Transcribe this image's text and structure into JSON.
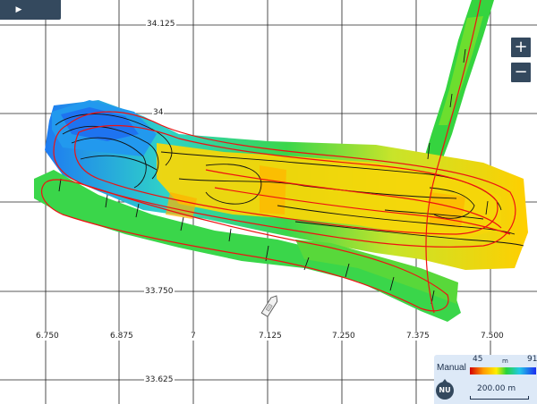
{
  "controls": {
    "play": "▶",
    "zoom_in": "+",
    "zoom_out": "−"
  },
  "grid": {
    "lat_labels": [
      "34.125",
      "34",
      "33.750",
      "33.625"
    ],
    "lon_labels": [
      "6.750",
      "6.875",
      "7",
      "7.125",
      "7.250",
      "7.375",
      "7.500"
    ]
  },
  "legend": {
    "mode": "Manual",
    "depth_min": "45",
    "depth_unit": "m",
    "depth_max": "91",
    "north_label": "NU",
    "scale": "200.00 m"
  },
  "colors": {
    "grid_line": "#222222",
    "track_line": "#ee1111",
    "contour_line": "#111111",
    "panel_bg": "#dde9f7",
    "control_bg": "#34495e",
    "depth_shallow": "#ffdd00",
    "depth_mid": "#2fd24a",
    "depth_deep": "#1e62f0"
  },
  "icons": {
    "boat": "boat-icon",
    "north": "north-arrow-icon"
  }
}
